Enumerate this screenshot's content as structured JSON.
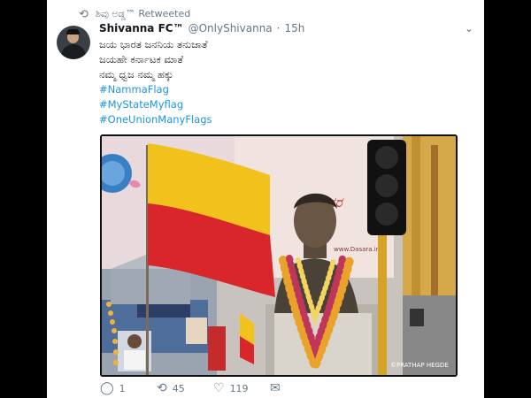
{
  "retweet": {
    "icon": "retweet-icon",
    "text": "ಶಿವು ಅಡ್ಡ™ Retweeted"
  },
  "tweet": {
    "name": "Shivanna FC™",
    "handle": "@OnlyShivanna",
    "separator": "·",
    "time": "15h",
    "lines": [
      "ಜಯ ಭಾರತ ಜನನಿಯ ತನುಜಾತೆ",
      "ಜಯಹೇ ಕರ್ನಾಟಕ ಮಾತೆ",
      "ನಮ್ಮ ಧ್ವಜ ನಮ್ಮ ಹಕ್ಕು"
    ],
    "hashtags": [
      "#NammaFlag",
      "#MyStateMyflag",
      "#OneUnionManyFlags"
    ]
  },
  "media": {
    "watermark": "©PRATHAP HEGDE",
    "poster_text": "www.Dasara.in",
    "flag_colors": [
      "#f2c21c",
      "#d8262a"
    ]
  },
  "actions": {
    "reply_count": "1",
    "retweet_count": "45",
    "like_count": "119"
  },
  "colors": {
    "link": "#1b95e0",
    "muted": "#657786"
  }
}
